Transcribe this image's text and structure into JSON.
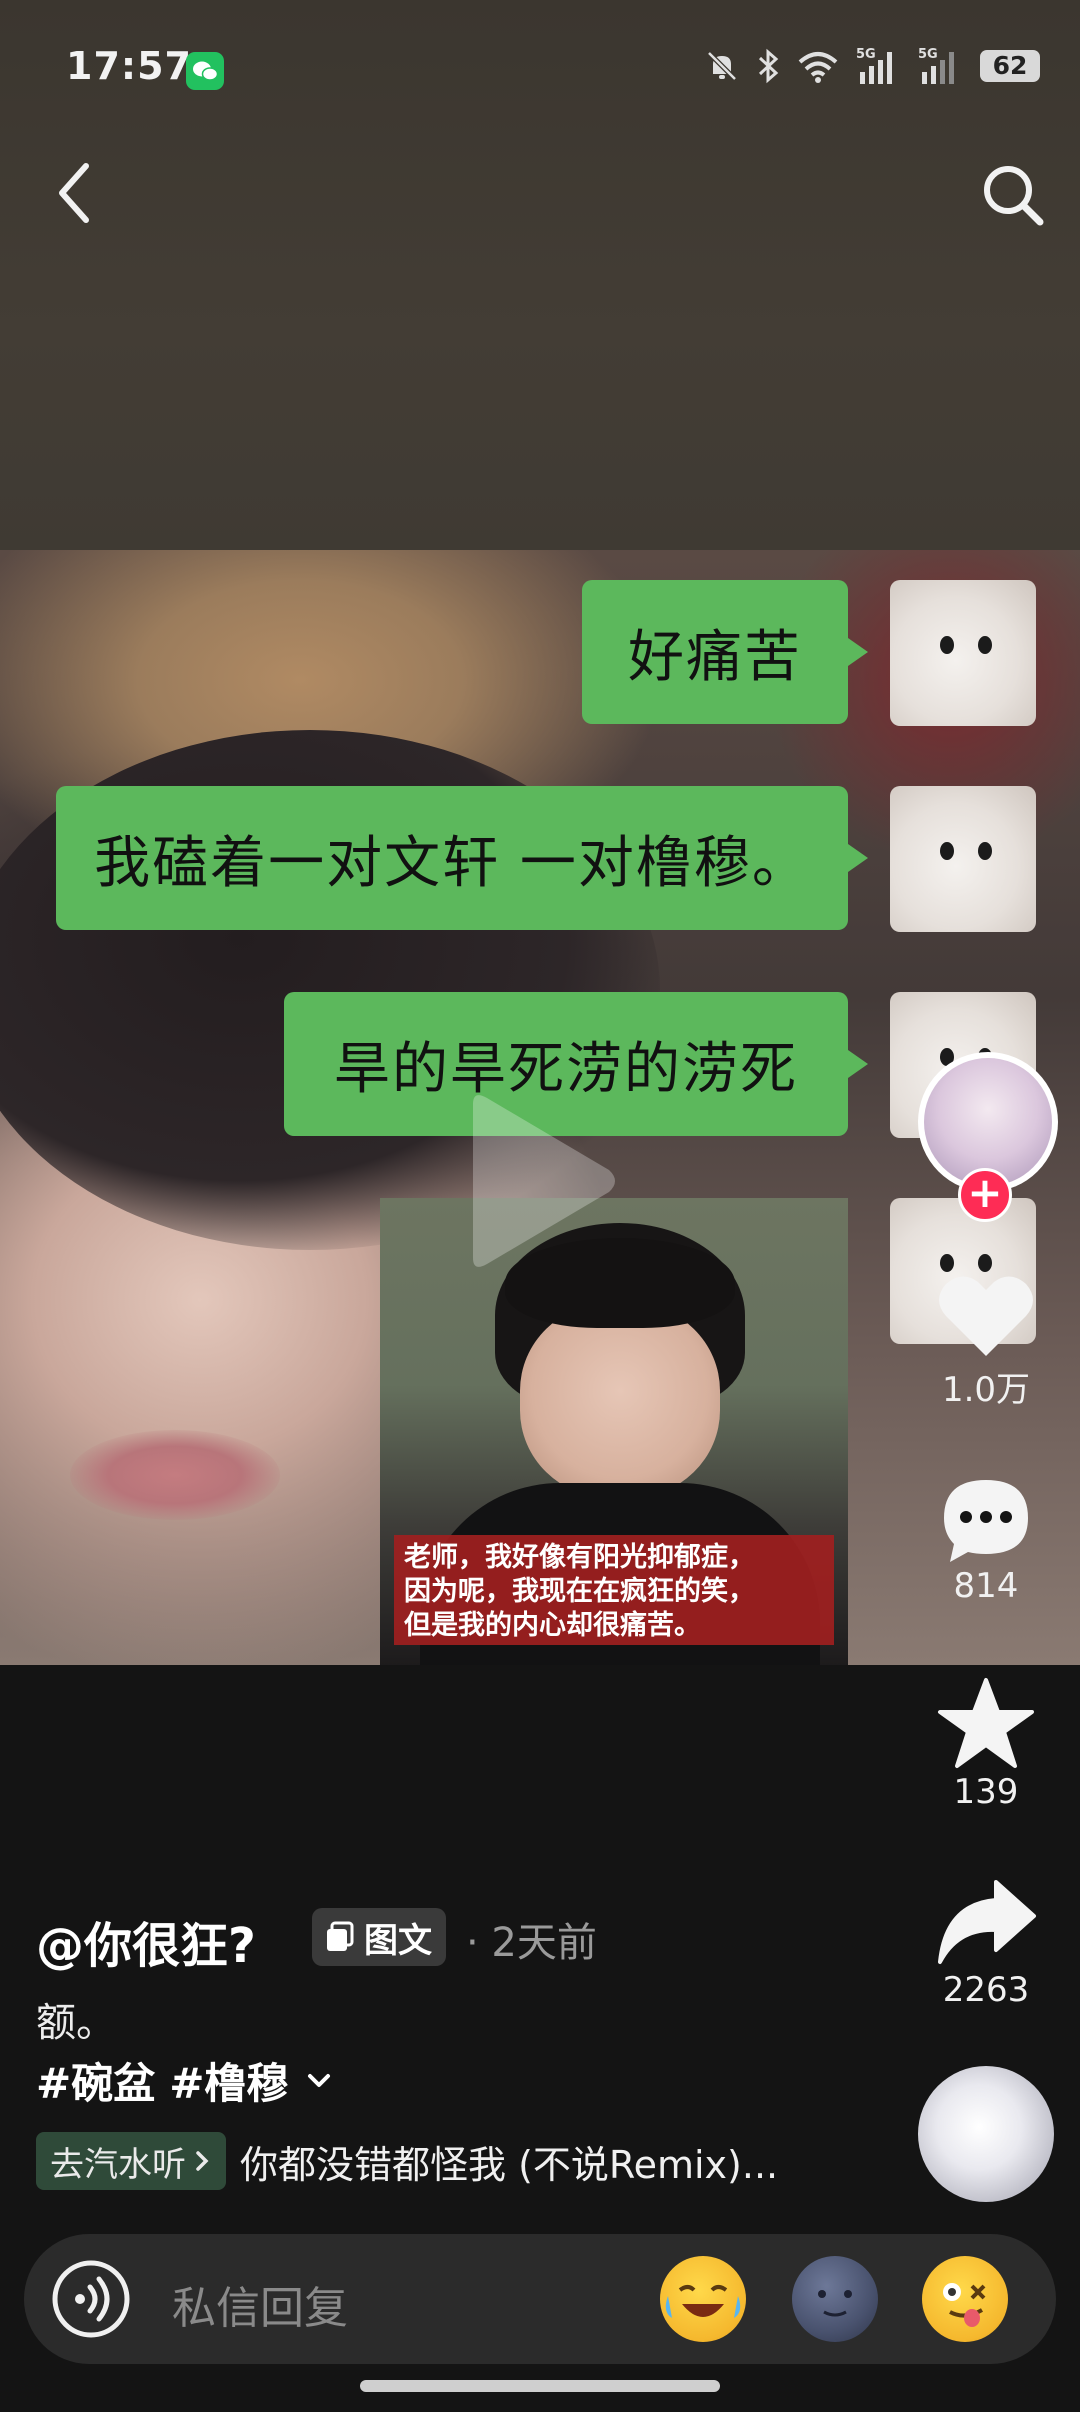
{
  "status_bar": {
    "time": "17:57",
    "battery": "62",
    "icons": [
      "wechat-icon",
      "mute-bell-icon",
      "bluetooth-icon",
      "wifi-icon",
      "5g-signal-icon",
      "5g-signal-icon",
      "battery-icon"
    ]
  },
  "nav": {
    "back_icon": "chevron-left-icon",
    "search_icon": "search-icon"
  },
  "chat": {
    "messages": [
      "好痛苦",
      "我磕着一对文轩 一对橹穆。",
      "旱的旱死涝的涝死"
    ],
    "photo_caption": "老师，我好像有阳光抑郁症，\n因为呢，我现在在疯狂的笑，\n但是我的内心却很痛苦。"
  },
  "actions": {
    "likes": "1.0万",
    "comments": "814",
    "favorites": "139",
    "shares": "2263"
  },
  "post": {
    "author": "@你很狂?",
    "type_tag": "图文",
    "time_ago": "· 2天前",
    "description": "额。",
    "hashtags": [
      "#碗盆",
      "#橹穆"
    ],
    "music_chip": "去汽水听",
    "music_title": "你都没错都怪我 (不说Remix)..."
  },
  "reply": {
    "placeholder": "私信回复"
  },
  "colors": {
    "bubble": "#5cb85c",
    "follow": "#fe2c55",
    "music_chip": "#2f4a39"
  }
}
